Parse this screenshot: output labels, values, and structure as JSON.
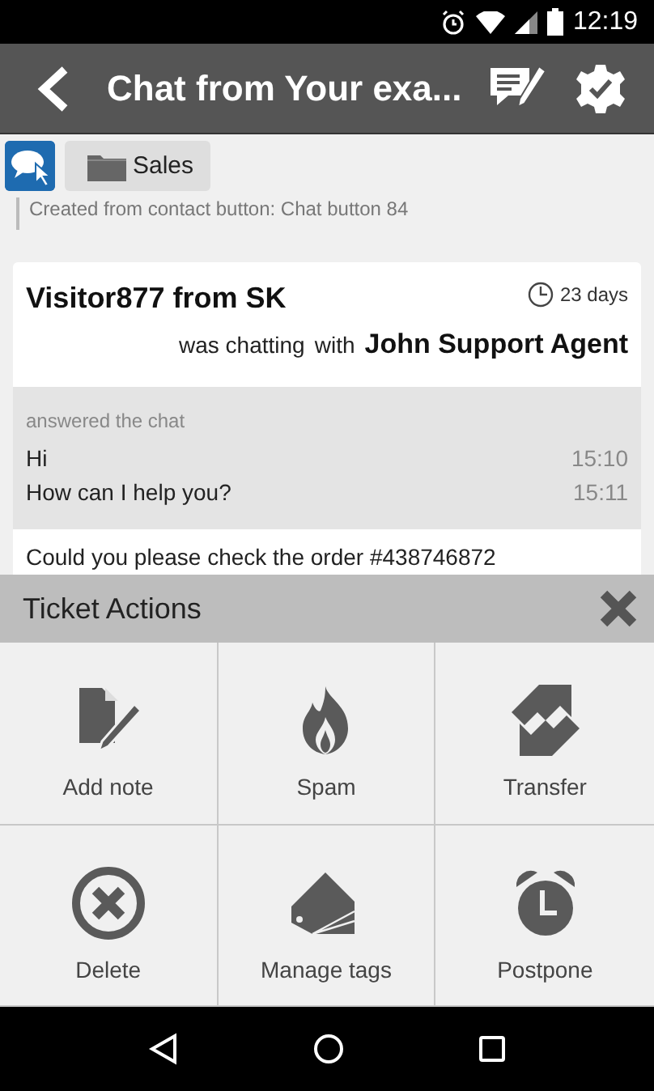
{
  "status_bar": {
    "time": "12:19"
  },
  "app_bar": {
    "title": "Chat from Your exa..."
  },
  "ticket": {
    "department": "Sales",
    "note": "Created from contact button: Chat button 84"
  },
  "chat": {
    "visitor": "Visitor877 from SK",
    "age": "23 days",
    "chatting_label": "was chatting",
    "with_label": "with",
    "agent": "John Support Agent",
    "answered": "answered the chat",
    "messages": [
      {
        "text": "Hi",
        "time": "15:10"
      },
      {
        "text": "How can I help you?",
        "time": "15:11"
      }
    ],
    "visitor_message": "Could you please check the order #438746872"
  },
  "sheet": {
    "title": "Ticket Actions",
    "actions": [
      {
        "kind": "note",
        "label": "Add note"
      },
      {
        "kind": "spam",
        "label": "Spam"
      },
      {
        "kind": "transfer",
        "label": "Transfer"
      },
      {
        "kind": "delete",
        "label": "Delete"
      },
      {
        "kind": "tags",
        "label": "Manage tags"
      },
      {
        "kind": "postpone",
        "label": "Postpone"
      }
    ]
  }
}
